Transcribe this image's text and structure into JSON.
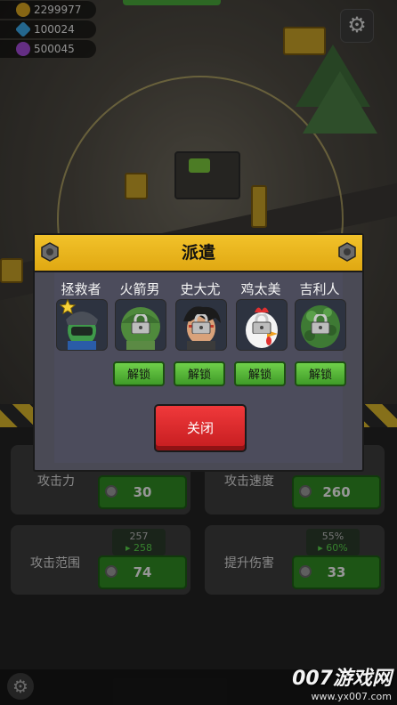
{
  "resources": [
    {
      "icon": "gold-coin-icon",
      "color": "#d9a521",
      "value": "2299977"
    },
    {
      "icon": "blue-gem-icon",
      "color": "#3aa6e6",
      "value": "100024"
    },
    {
      "icon": "purple-orb-icon",
      "color": "#a24bd6",
      "value": "500045"
    }
  ],
  "settings_icon": "gear-icon",
  "dialog": {
    "title": "派遣",
    "heroes": [
      {
        "name": "拯救者",
        "portrait": "rescuer-portrait",
        "locked": false,
        "starred": true,
        "unlock_label": ""
      },
      {
        "name": "火箭男",
        "portrait": "rocket-man-portrait",
        "locked": true,
        "starred": false,
        "unlock_label": "解锁"
      },
      {
        "name": "史大尤",
        "portrait": "shi-dayou-portrait",
        "locked": true,
        "starred": false,
        "unlock_label": "解锁"
      },
      {
        "name": "鸡太美",
        "portrait": "chicken-portrait",
        "locked": true,
        "starred": false,
        "unlock_label": "解锁"
      },
      {
        "name": "吉利人",
        "portrait": "ghillie-man-portrait",
        "locked": true,
        "starred": false,
        "unlock_label": "解锁"
      }
    ],
    "close_label": "关闭"
  },
  "upgrades": [
    {
      "label": "攻击力",
      "cost": "30",
      "preview_current": "",
      "preview_next": ""
    },
    {
      "label": "攻击速度",
      "cost": "260",
      "preview_current": "",
      "preview_next": ""
    },
    {
      "label": "攻击范围",
      "cost": "74",
      "preview_current": "257",
      "preview_next": "▸ 258"
    },
    {
      "label": "提升伤害",
      "cost": "33",
      "preview_current": "55%",
      "preview_next": "▸ 60%"
    }
  ],
  "watermark": {
    "brand": "007游戏网",
    "url": "www.yx007.com"
  },
  "colors": {
    "header_yellow": "#f2c22a",
    "unlock_green": "#5bbd3a",
    "close_red": "#e02a2c",
    "upgrade_green": "#2f8a22"
  }
}
